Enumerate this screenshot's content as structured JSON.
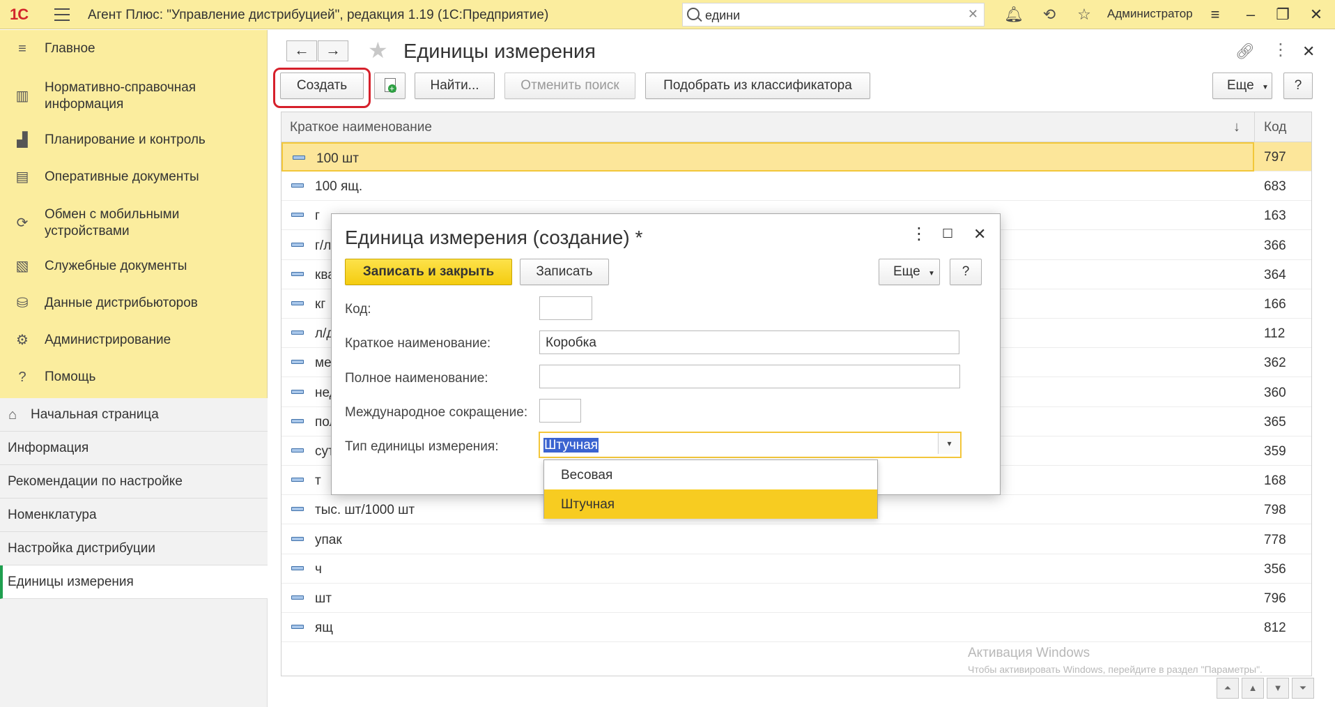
{
  "app": {
    "logo": "1С",
    "title": "Агент Плюс: \"Управление дистрибуцией\", редакция 1.19  (1С:Предприятие)",
    "search_value": "едини",
    "user": "Администратор"
  },
  "sidebar": {
    "sections": [
      {
        "label": "Главное",
        "icon": "menu-lines-icon"
      },
      {
        "label": "Нормативно-справочная информация",
        "icon": "bars-chart-icon"
      },
      {
        "label": "Планирование и контроль",
        "icon": "chart-icon"
      },
      {
        "label": "Оперативные документы",
        "icon": "documents-icon"
      },
      {
        "label": "Обмен с мобильными устройствами",
        "icon": "sync-icon"
      },
      {
        "label": "Служебные документы",
        "icon": "service-docs-icon"
      },
      {
        "label": "Данные дистрибьюторов",
        "icon": "database-icon"
      },
      {
        "label": "Администрирование",
        "icon": "gear-icon"
      },
      {
        "label": "Помощь",
        "icon": "question-icon"
      }
    ],
    "open_windows": [
      {
        "label": "Начальная страница"
      },
      {
        "label": "Информация"
      },
      {
        "label": "Рекомендации по настройке"
      },
      {
        "label": "Номенклатура"
      },
      {
        "label": "Настройка дистрибуции"
      },
      {
        "label": "Единицы измерения"
      }
    ]
  },
  "form": {
    "title": "Единицы измерения",
    "toolbar": {
      "create": "Создать",
      "find": "Найти...",
      "cancel_search": "Отменить поиск",
      "pick_classifier": "Подобрать из классификатора",
      "more": "Еще",
      "help": "?"
    },
    "table": {
      "col_name": "Краткое наименование",
      "col_code": "Код",
      "sort_glyph": "↓",
      "rows": [
        {
          "name": "100 шт",
          "code": "797"
        },
        {
          "name": "100 ящ.",
          "code": "683"
        },
        {
          "name": "г",
          "code": "163"
        },
        {
          "name": "г/л",
          "code": "366"
        },
        {
          "name": "ква",
          "code": "364"
        },
        {
          "name": "кг",
          "code": "166"
        },
        {
          "name": "л/д",
          "code": "112"
        },
        {
          "name": "ме",
          "code": "362"
        },
        {
          "name": "нед",
          "code": "360"
        },
        {
          "name": "пол",
          "code": "365"
        },
        {
          "name": "сут",
          "code": "359"
        },
        {
          "name": "т",
          "code": "168"
        },
        {
          "name": "тыс. шт/1000 шт",
          "code": "798"
        },
        {
          "name": "упак",
          "code": "778"
        },
        {
          "name": "ч",
          "code": "356"
        },
        {
          "name": "шт",
          "code": "796"
        },
        {
          "name": "ящ",
          "code": "812"
        }
      ]
    },
    "watermark_title": "Активация Windows",
    "watermark_text": "Чтобы активировать Windows, перейдите в раздел \"Параметры\"."
  },
  "dialog": {
    "title": "Единица измерения (создание) *",
    "save_close": "Записать и закрыть",
    "save": "Записать",
    "more": "Еще",
    "help": "?",
    "fields": {
      "code_label": "Код:",
      "code_value": "",
      "short_label": "Краткое наименование:",
      "short_value": "Коробка",
      "full_label": "Полное наименование:",
      "full_value": "",
      "intl_label": "Международное сокращение:",
      "intl_value": "",
      "type_label": "Тип единицы измерения:",
      "type_value": "Штучная"
    },
    "type_options": [
      "Весовая",
      "Штучная"
    ]
  },
  "colors": {
    "accent_yellow": "#fbed9e",
    "selected_row": "#fce69a",
    "primary_button": "#f4cc10",
    "highlight_red": "#d6202b",
    "active_green": "#1f9f4f"
  }
}
